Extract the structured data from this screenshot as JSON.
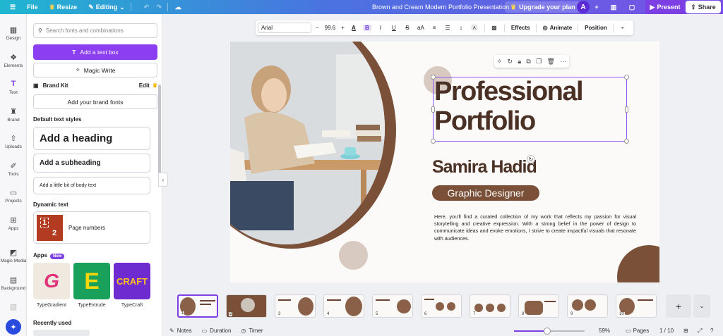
{
  "topbar": {
    "file": "File",
    "resize": "Resize",
    "editing": "Editing",
    "doc_title": "Brown and Cream Modern Portfolio Presentation",
    "upgrade": "Upgrade your plan",
    "avatar_initial": "A",
    "present": "Present",
    "share": "Share"
  },
  "rail": {
    "items": [
      {
        "label": "Design",
        "icon": "design-icon"
      },
      {
        "label": "Elements",
        "icon": "elements-icon"
      },
      {
        "label": "Text",
        "icon": "text-icon"
      },
      {
        "label": "Brand",
        "icon": "brand-icon"
      },
      {
        "label": "Uploads",
        "icon": "uploads-icon"
      },
      {
        "label": "Tools",
        "icon": "tools-icon"
      },
      {
        "label": "Projects",
        "icon": "projects-icon"
      },
      {
        "label": "Apps",
        "icon": "apps-icon"
      },
      {
        "label": "Magic Media",
        "icon": "magic-media-icon"
      },
      {
        "label": "Background",
        "icon": "background-icon"
      }
    ]
  },
  "panel": {
    "search_placeholder": "Search fonts and combinations",
    "add_text_box": "Add a text box",
    "magic_write": "Magic Write",
    "brand_kit": "Brand Kit",
    "brand_edit": "Edit",
    "add_brand_fonts": "Add your brand fonts",
    "default_styles_label": "Default text styles",
    "heading": "Add a heading",
    "subheading": "Add a subheading",
    "body": "Add a little bit of body text",
    "dynamic_label": "Dynamic text",
    "page_numbers": "Page numbers",
    "dyn_num_1": "1",
    "dyn_num_2": "2",
    "apps_label": "Apps",
    "apps_new": "New",
    "apps": [
      {
        "name": "TypeGradient",
        "glyph": "G"
      },
      {
        "name": "TypeExtrude",
        "glyph": "E"
      },
      {
        "name": "TypeCraft",
        "glyph": "CRAFT"
      }
    ],
    "recently_used": "Recently used"
  },
  "format_toolbar": {
    "font": "Arial",
    "size": "99.6",
    "minus": "−",
    "plus": "+",
    "effects": "Effects",
    "animate": "Animate",
    "position": "Position"
  },
  "slide": {
    "title_line1": "Professional",
    "title_line2": "Portfolio",
    "name": "Samira Hadid",
    "role": "Graphic Designer",
    "paragraph": "Here, you'll find a curated collection of my work that reflects my passion for visual storytelling and creative expression. With a strong belief in the power of design to communicate ideas and evoke emotions, I strive to create impactful visuals that resonate with audiences."
  },
  "strip": {
    "pages": [
      {
        "num": "1",
        "title": "Professional Portfolio"
      },
      {
        "num": "2",
        "title": ""
      },
      {
        "num": "3",
        "title": "About ME!"
      },
      {
        "num": "4",
        "title": "Skills and Expertise"
      },
      {
        "num": "5",
        "title": "Portfolio Overview"
      },
      {
        "num": "6",
        "title": "Branding Projects"
      },
      {
        "num": "7",
        "title": "Portfolio Overview"
      },
      {
        "num": "8",
        "title": "Portfolio Overview"
      },
      {
        "num": "9",
        "title": "Client Testimonials"
      },
      {
        "num": "10",
        "title": ""
      }
    ]
  },
  "bottombar": {
    "notes": "Notes",
    "duration": "Duration",
    "timer": "Timer",
    "zoom_percent": 59,
    "zoom": "59%",
    "pages": "Pages",
    "page_count": "1 / 10"
  },
  "colors": {
    "accent": "#7b3fe4",
    "brown": "#7a5038",
    "dark_brown": "#4a3025",
    "slide_bg": "#fcfaf8"
  }
}
